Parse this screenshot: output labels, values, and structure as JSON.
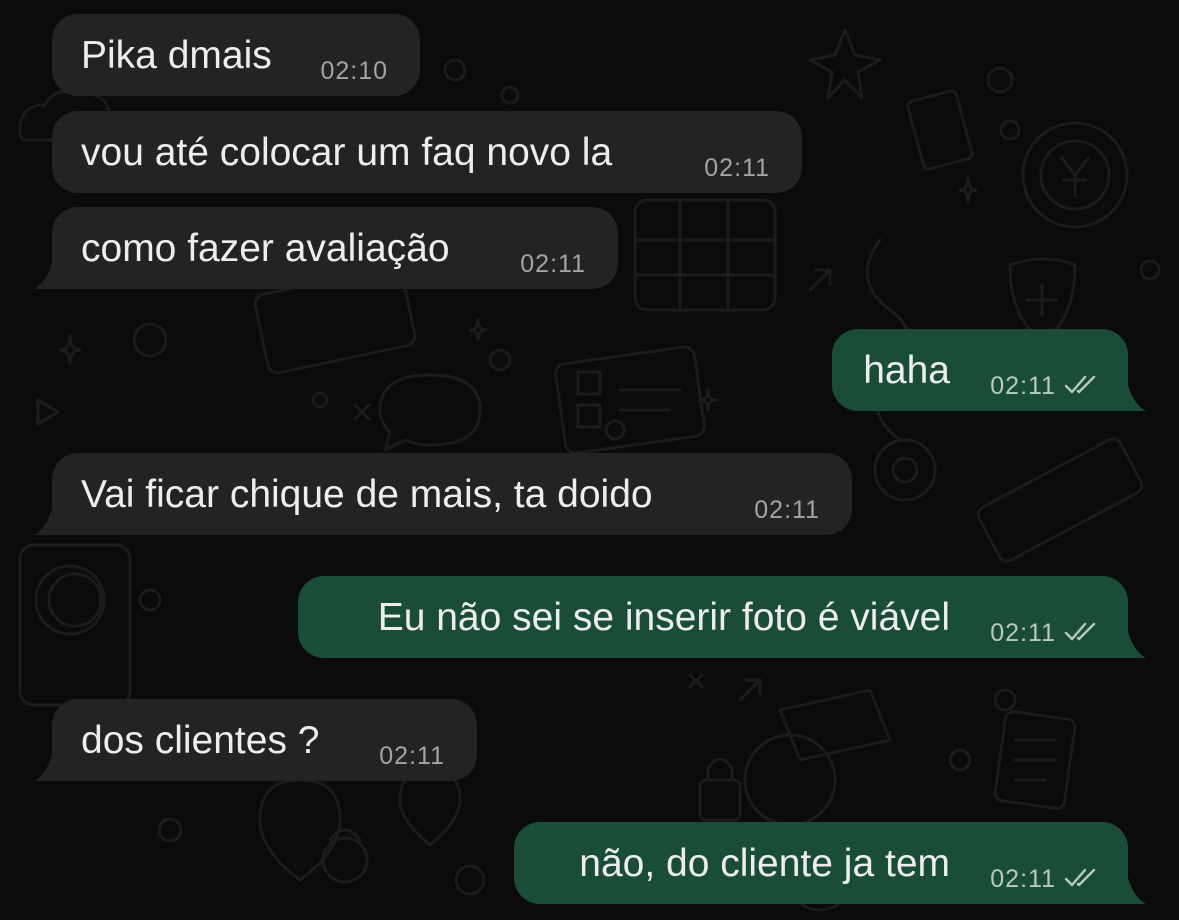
{
  "messages": [
    {
      "side": "in",
      "text": "Pika dmais",
      "time": "02:10",
      "tail": false
    },
    {
      "side": "in",
      "text": "vou até colocar um faq novo la",
      "time": "02:11",
      "tail": false
    },
    {
      "side": "in",
      "text": "como fazer avaliação",
      "time": "02:11",
      "tail": true
    },
    {
      "side": "out",
      "text": "haha",
      "time": "02:11",
      "tail": true,
      "status": "read-double-check-icon"
    },
    {
      "side": "in",
      "text": "Vai ficar chique de mais, ta doido",
      "time": "02:11",
      "tail": true
    },
    {
      "side": "out",
      "text": "Eu não sei se inserir foto é viável",
      "time": "02:11",
      "tail": true,
      "status": "read-double-check-icon"
    },
    {
      "side": "in",
      "text": "dos clientes ?",
      "time": "02:11",
      "tail": true
    },
    {
      "side": "out",
      "text": "não, do cliente ja tem",
      "time": "02:11",
      "tail": true,
      "status": "read-double-check-icon"
    }
  ],
  "colors": {
    "background": "#0b0b0b",
    "incoming_bubble": "#232323",
    "outgoing_bubble": "#1a4d38",
    "timestamp": "#a4a4a4"
  }
}
